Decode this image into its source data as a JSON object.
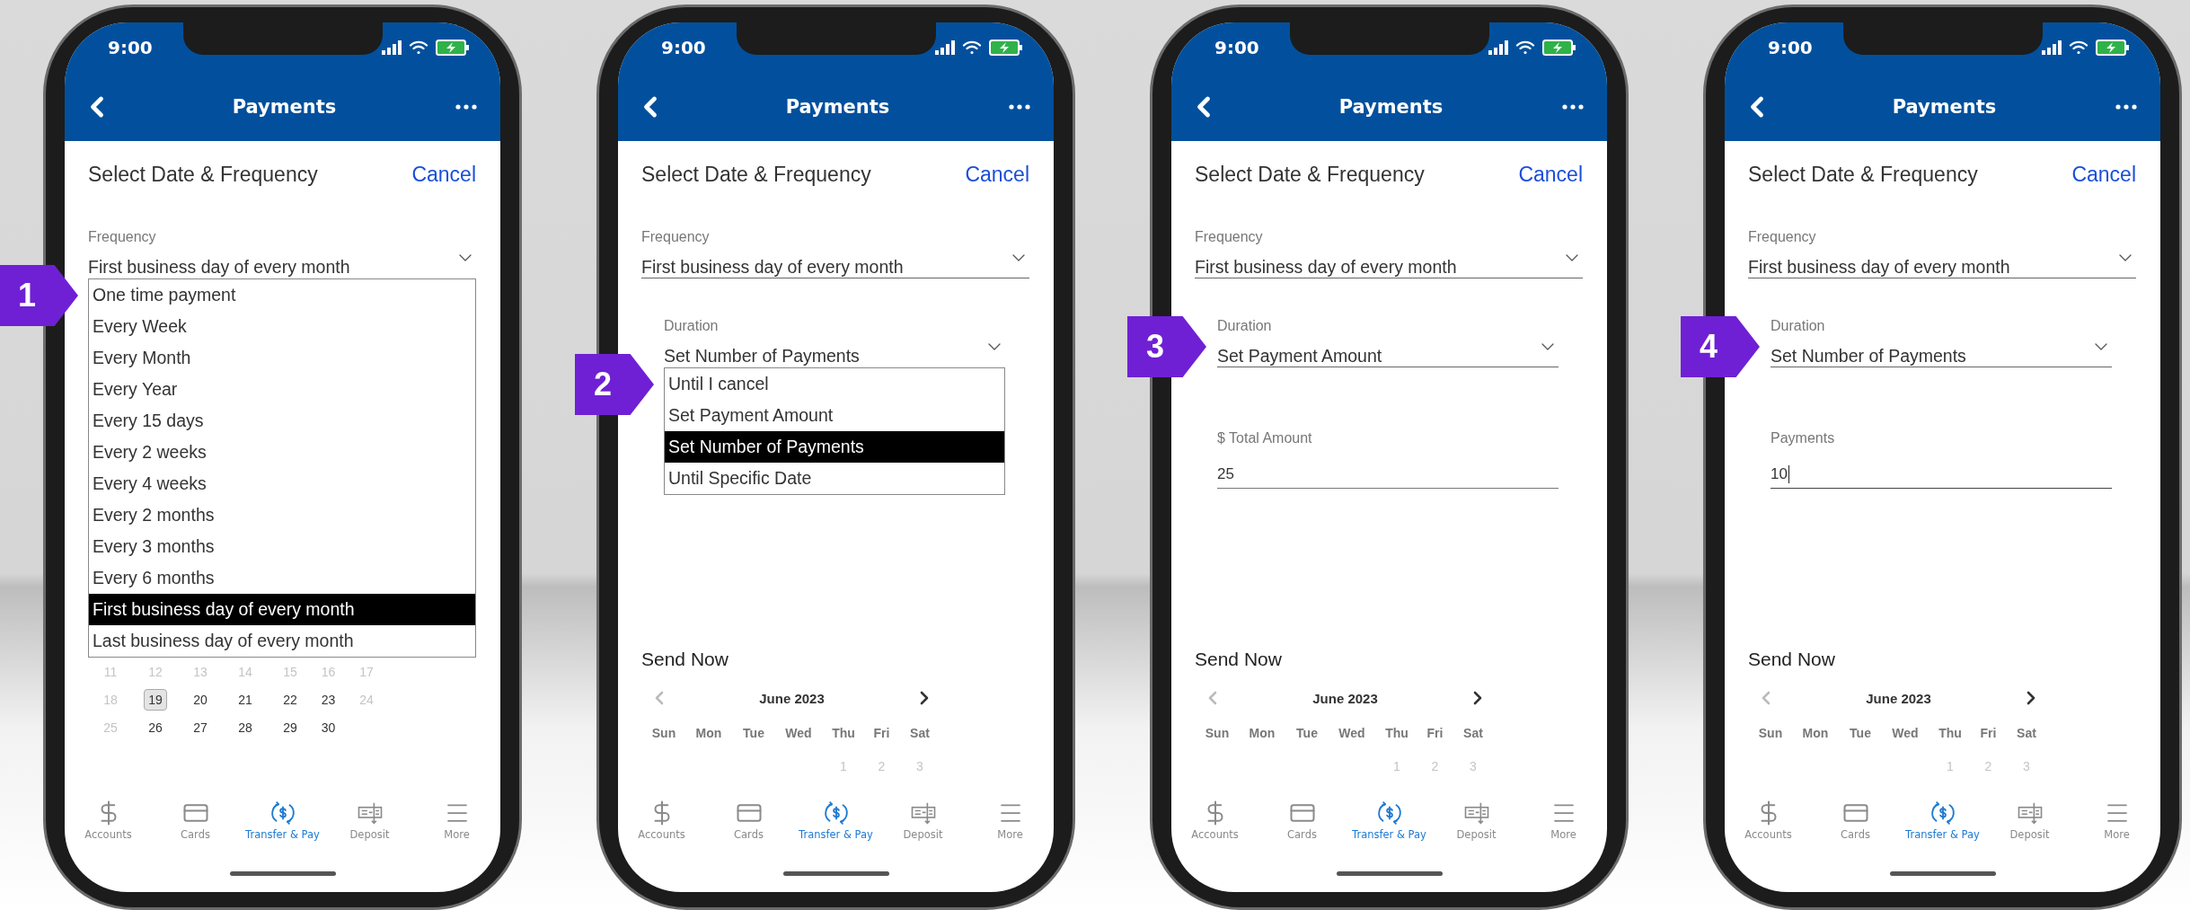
{
  "screens": [
    {
      "status_bar": {
        "time": "9:00"
      },
      "header": {
        "title": "Payments"
      },
      "sheet": {
        "title": "Select Date & Frequency",
        "cancel": "Cancel"
      },
      "step_badge": "1",
      "frequency": {
        "label": "Frequency",
        "value": "First business day of every month",
        "expanded": true,
        "options": [
          {
            "label": "One time payment",
            "selected": false
          },
          {
            "label": "Every Week",
            "selected": false
          },
          {
            "label": "Every Month",
            "selected": false
          },
          {
            "label": "Every Year",
            "selected": false
          },
          {
            "label": "Every 15 days",
            "selected": false
          },
          {
            "label": "Every 2 weeks",
            "selected": false
          },
          {
            "label": "Every 4 weeks",
            "selected": false
          },
          {
            "label": "Every 2 months",
            "selected": false
          },
          {
            "label": "Every 3 months",
            "selected": false
          },
          {
            "label": "Every 6 months",
            "selected": false
          },
          {
            "label": "First business day of every month",
            "selected": true
          },
          {
            "label": "Last business day of every month",
            "selected": false
          }
        ]
      },
      "calendar": {
        "weeks": [
          {
            "days": [
              {
                "label": "11",
                "disabled": true,
                "selected": false
              },
              {
                "label": "12",
                "disabled": true,
                "selected": false
              },
              {
                "label": "13",
                "disabled": true,
                "selected": false
              },
              {
                "label": "14",
                "disabled": true,
                "selected": false
              },
              {
                "label": "15",
                "disabled": true,
                "selected": false
              },
              {
                "label": "16",
                "disabled": true,
                "selected": false
              },
              {
                "label": "17",
                "disabled": true,
                "selected": false
              }
            ]
          },
          {
            "days": [
              {
                "label": "18",
                "disabled": true,
                "selected": false
              },
              {
                "label": "19",
                "disabled": false,
                "selected": true
              },
              {
                "label": "20",
                "disabled": false,
                "selected": false
              },
              {
                "label": "21",
                "disabled": false,
                "selected": false
              },
              {
                "label": "22",
                "disabled": false,
                "selected": false
              },
              {
                "label": "23",
                "disabled": false,
                "selected": false
              },
              {
                "label": "24",
                "disabled": true,
                "selected": false
              }
            ]
          },
          {
            "days": [
              {
                "label": "25",
                "disabled": true,
                "selected": false
              },
              {
                "label": "26",
                "disabled": false,
                "selected": false
              },
              {
                "label": "27",
                "disabled": false,
                "selected": false
              },
              {
                "label": "28",
                "disabled": false,
                "selected": false
              },
              {
                "label": "29",
                "disabled": false,
                "selected": false
              },
              {
                "label": "30",
                "disabled": false,
                "selected": false
              }
            ]
          }
        ]
      },
      "tabs": [
        {
          "label": "Accounts",
          "selected": false
        },
        {
          "label": "Cards",
          "selected": false
        },
        {
          "label": "Transfer & Pay",
          "selected": true
        },
        {
          "label": "Deposit",
          "selected": false
        },
        {
          "label": "More",
          "selected": false
        }
      ]
    },
    {
      "status_bar": {
        "time": "9:00"
      },
      "header": {
        "title": "Payments"
      },
      "sheet": {
        "title": "Select Date & Frequency",
        "cancel": "Cancel"
      },
      "step_badge": "2",
      "frequency": {
        "label": "Frequency",
        "value": "First business day of every month",
        "expanded": false
      },
      "duration": {
        "label": "Duration",
        "value": "Set Number of Payments",
        "expanded": true,
        "options": [
          {
            "label": "Until I cancel",
            "selected": false
          },
          {
            "label": "Set Payment Amount",
            "selected": false
          },
          {
            "label": "Set Number of Payments",
            "selected": true
          },
          {
            "label": "Until Specific Date",
            "selected": false
          }
        ]
      },
      "calendar": {
        "title": "Send Now",
        "month": "June 2023",
        "weekdays": [
          "Sun",
          "Mon",
          "Tue",
          "Wed",
          "Thu",
          "Fri",
          "Sat"
        ],
        "weeks": [
          {
            "days": [
              {
                "label": "1",
                "disabled": true,
                "selected": false
              },
              {
                "label": "2",
                "disabled": true,
                "selected": false
              },
              {
                "label": "3",
                "disabled": true,
                "selected": false
              }
            ]
          }
        ]
      },
      "tabs": [
        {
          "label": "Accounts",
          "selected": false
        },
        {
          "label": "Cards",
          "selected": false
        },
        {
          "label": "Transfer & Pay",
          "selected": true
        },
        {
          "label": "Deposit",
          "selected": false
        },
        {
          "label": "More",
          "selected": false
        }
      ]
    },
    {
      "status_bar": {
        "time": "9:00"
      },
      "header": {
        "title": "Payments"
      },
      "sheet": {
        "title": "Select Date & Frequency",
        "cancel": "Cancel"
      },
      "step_badge": "3",
      "frequency": {
        "label": "Frequency",
        "value": "First business day of every month",
        "expanded": false
      },
      "duration": {
        "label": "Duration",
        "value": "Set Payment Amount",
        "expanded": false
      },
      "amount": {
        "label": "$ Total Amount",
        "value": "25",
        "focused": false
      },
      "calendar": {
        "title": "Send Now",
        "month": "June 2023",
        "weekdays": [
          "Sun",
          "Mon",
          "Tue",
          "Wed",
          "Thu",
          "Fri",
          "Sat"
        ],
        "weeks": [
          {
            "days": [
              {
                "label": "1",
                "disabled": true,
                "selected": false
              },
              {
                "label": "2",
                "disabled": true,
                "selected": false
              },
              {
                "label": "3",
                "disabled": true,
                "selected": false
              }
            ]
          }
        ]
      },
      "tabs": [
        {
          "label": "Accounts",
          "selected": false
        },
        {
          "label": "Cards",
          "selected": false
        },
        {
          "label": "Transfer & Pay",
          "selected": true
        },
        {
          "label": "Deposit",
          "selected": false
        },
        {
          "label": "More",
          "selected": false
        }
      ]
    },
    {
      "status_bar": {
        "time": "9:00"
      },
      "header": {
        "title": "Payments"
      },
      "sheet": {
        "title": "Select Date & Frequency",
        "cancel": "Cancel"
      },
      "step_badge": "4",
      "frequency": {
        "label": "Frequency",
        "value": "First business day of every month",
        "expanded": false
      },
      "duration": {
        "label": "Duration",
        "value": "Set Number of Payments",
        "expanded": false
      },
      "amount": {
        "label": "Payments",
        "value": "10",
        "focused": true
      },
      "calendar": {
        "title": "Send Now",
        "month": "June 2023",
        "weekdays": [
          "Sun",
          "Mon",
          "Tue",
          "Wed",
          "Thu",
          "Fri",
          "Sat"
        ],
        "weeks": [
          {
            "days": [
              {
                "label": "1",
                "disabled": true,
                "selected": false
              },
              {
                "label": "2",
                "disabled": true,
                "selected": false
              },
              {
                "label": "3",
                "disabled": true,
                "selected": false
              }
            ]
          }
        ]
      },
      "tabs": [
        {
          "label": "Accounts",
          "selected": false
        },
        {
          "label": "Cards",
          "selected": false
        },
        {
          "label": "Transfer & Pay",
          "selected": true
        },
        {
          "label": "Deposit",
          "selected": false
        },
        {
          "label": "More",
          "selected": false
        }
      ]
    }
  ]
}
